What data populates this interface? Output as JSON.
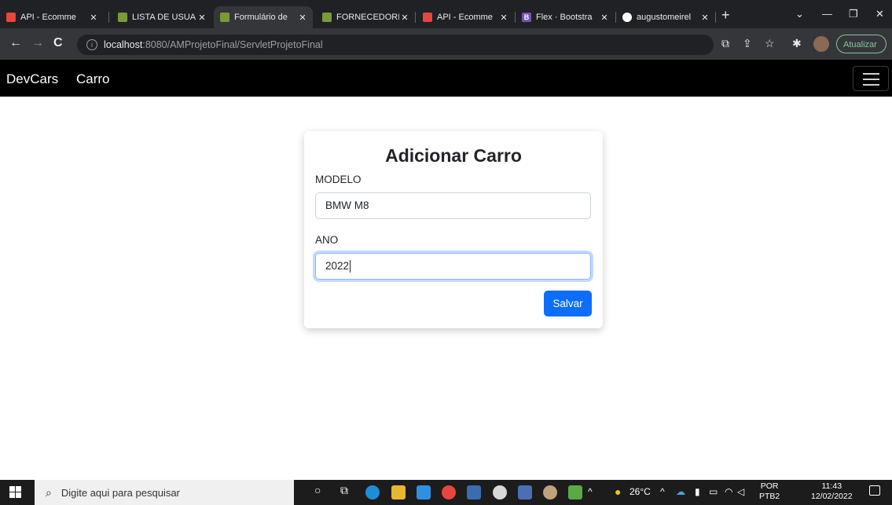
{
  "browser": {
    "tabs": [
      {
        "title": "API - Ecomme",
        "favicon_color": "#e8453c"
      },
      {
        "title": "LISTA DE USUA",
        "favicon_color": "#7a9a3a"
      },
      {
        "title": "Formulário de",
        "favicon_color": "#7a9a3a",
        "active": true
      },
      {
        "title": "FORNECEDORI",
        "favicon_color": "#7a9a3a"
      },
      {
        "title": "API - Ecomme",
        "favicon_color": "#e8453c"
      },
      {
        "title": "Flex · Bootstra",
        "favicon_color": "#7952b3"
      },
      {
        "title": "augustomeirel",
        "favicon_color": "#ffffff"
      }
    ],
    "new_tab_icon": "plus-icon",
    "address": {
      "host": "localhost",
      "path": ":8080/AMProjetoFinal/ServletProjetoFinal"
    },
    "update_label": "Atualizar"
  },
  "navbar": {
    "brand": "DevCars",
    "link": "Carro"
  },
  "form": {
    "title": "Adicionar Carro",
    "modelo_label": "MODELO",
    "modelo_value": "BMW M8",
    "ano_label": "ANO",
    "ano_value": "2022",
    "submit_label": "Salvar"
  },
  "taskbar": {
    "search_placeholder": "Digite aqui para pesquisar",
    "weather": "26°C",
    "language": "POR",
    "language_sub": "PTB2",
    "time": "11:43",
    "date": "12/02/2022"
  },
  "colors": {
    "primary": "#0d6efd",
    "navbar_bg": "#000000",
    "chrome_dark": "#202124"
  }
}
